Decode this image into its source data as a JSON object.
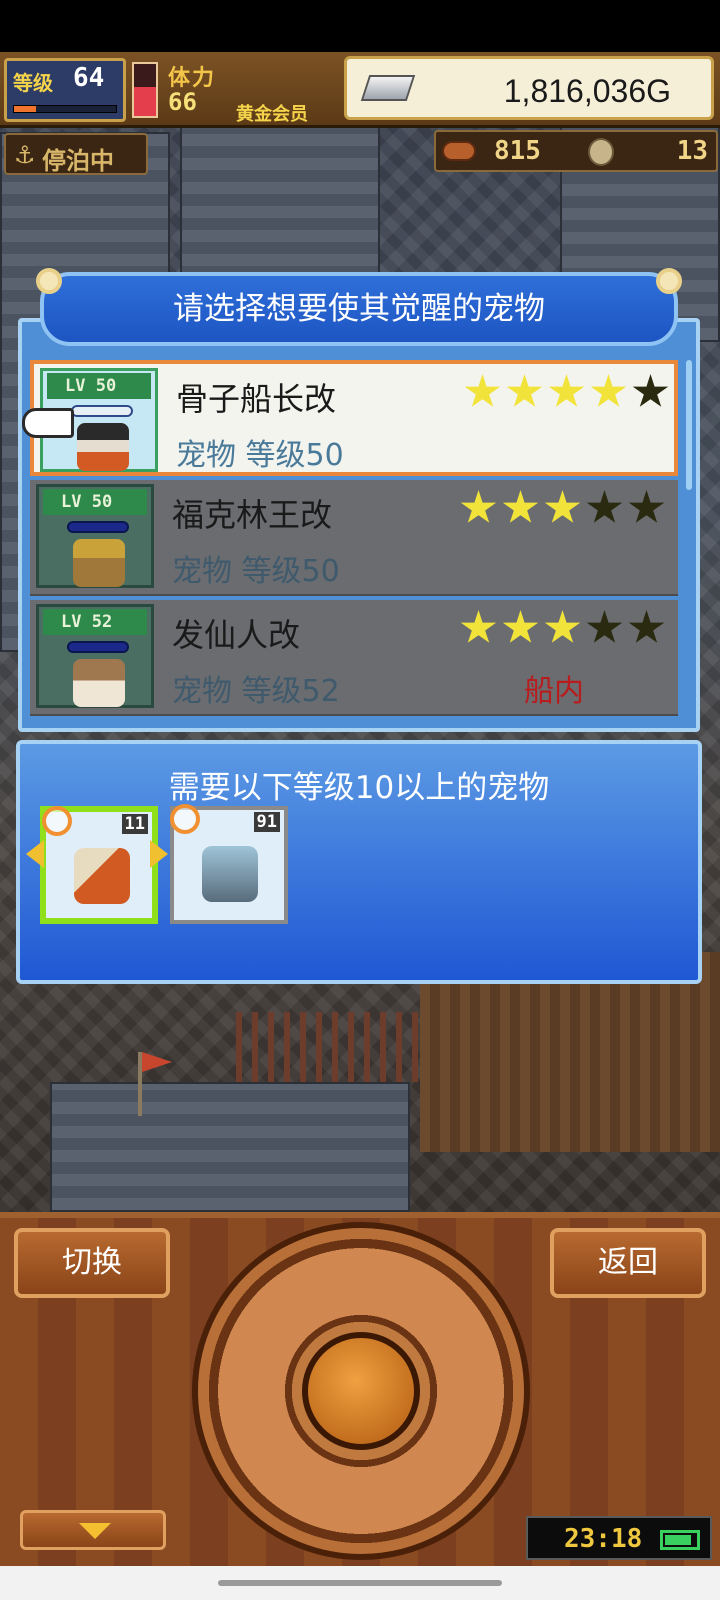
{
  "hud": {
    "level_label": "等级",
    "level_value": "64",
    "xp_fraction": 0.22,
    "stamina_label": "体力",
    "stamina_value": "66",
    "stamina_fraction": 0.55,
    "membership": "黄金会员",
    "gold": "1,816,036G",
    "anchor_status": "停泊中",
    "resource_food": "815",
    "resource_coin": "13"
  },
  "dialog": {
    "title": "请选择想要使其觉醒的宠物",
    "pets": [
      {
        "lv_badge": "LV 50",
        "name": "骨子船长改",
        "info": "宠物 等级50",
        "location": "",
        "stars": 4,
        "max_stars": 5,
        "selected": true
      },
      {
        "lv_badge": "LV 50",
        "name": "福克林王改",
        "info": "宠物 等级50",
        "location": "",
        "stars": 3,
        "max_stars": 5,
        "selected": false
      },
      {
        "lv_badge": "LV 52",
        "name": "发仙人改",
        "info": "宠物 等级52",
        "location": "船内",
        "stars": 3,
        "max_stars": 5,
        "selected": false
      }
    ]
  },
  "requirement": {
    "title": "需要以下等级10以上的宠物",
    "slots": [
      {
        "level": "11",
        "active": true
      },
      {
        "level": "91",
        "active": false
      }
    ]
  },
  "controls": {
    "switch_label": "切换",
    "back_label": "返回",
    "clock": "23:18"
  },
  "colors": {
    "accent_blue": "#1d55c2",
    "selected_border": "#e9883a",
    "star_on": "#f2e33a",
    "location_red": "#b81c1c"
  }
}
